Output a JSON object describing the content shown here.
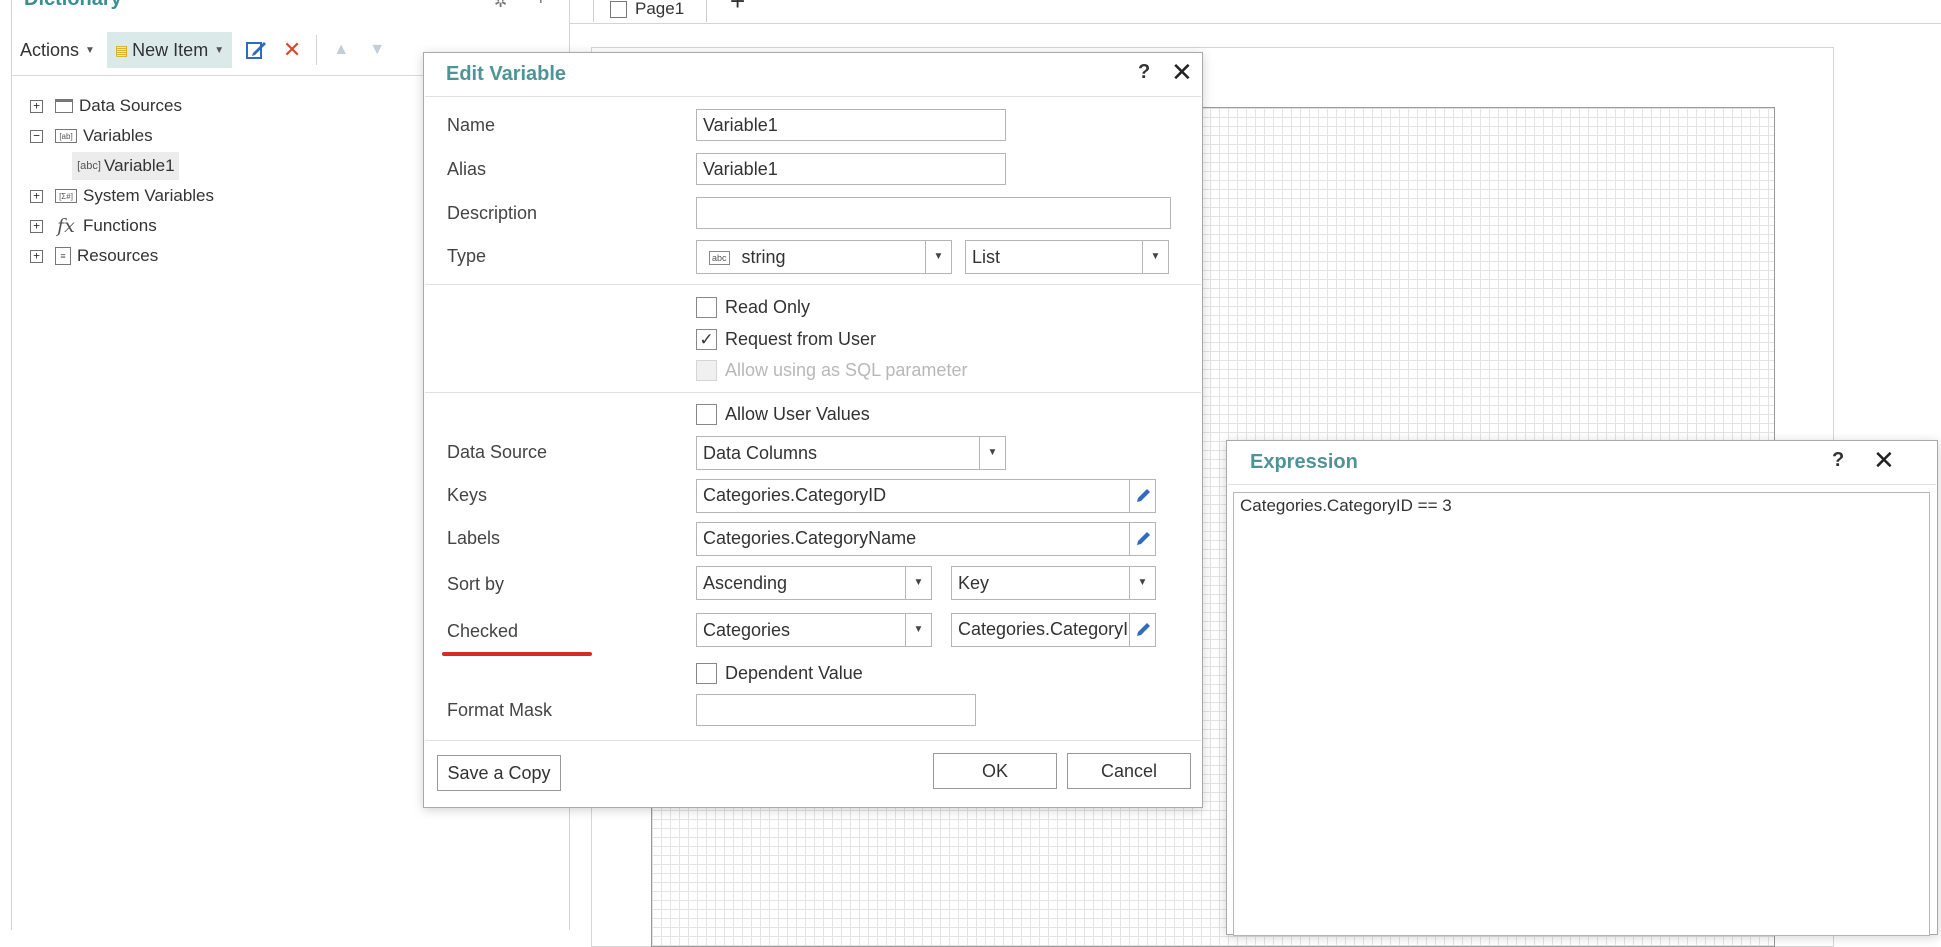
{
  "dictionary": {
    "title": "Dictionary",
    "toolbar": {
      "actions_label": "Actions",
      "new_item_label": "New Item"
    },
    "tree": [
      {
        "label": "Data Sources",
        "expander": "+"
      },
      {
        "label": "Variables",
        "expander": "−"
      },
      {
        "label": "Variable1"
      },
      {
        "label": "System Variables",
        "expander": "+"
      },
      {
        "label": "Functions",
        "expander": "+"
      },
      {
        "label": "Resources",
        "expander": "+"
      }
    ]
  },
  "designer": {
    "page_tab_label": "Page1"
  },
  "edit_variable": {
    "title": "Edit Variable",
    "help": "?",
    "close": "✕",
    "name_label": "Name",
    "name_value": "Variable1",
    "alias_label": "Alias",
    "alias_value": "Variable1",
    "description_label": "Description",
    "description_value": "",
    "type_label": "Type",
    "type_value": "string",
    "type_icon_text": "abc",
    "type_kind_value": "List",
    "read_only_label": "Read Only",
    "request_from_user_label": "Request from User",
    "sql_param_label": "Allow using as SQL parameter",
    "allow_user_values_label": "Allow User Values",
    "data_source_label": "Data Source",
    "data_source_value": "Data Columns",
    "keys_label": "Keys",
    "keys_value": "Categories.CategoryID",
    "labels_label": "Labels",
    "labels_value": "Categories.CategoryName",
    "sort_by_label": "Sort by",
    "sort_by_value": "Ascending",
    "sort_field_value": "Key",
    "checked_label": "Checked",
    "checked_source_value": "Categories",
    "checked_expr_value": "Categories.CategoryI",
    "dependent_value_label": "Dependent Value",
    "format_mask_label": "Format Mask",
    "format_mask_value": "",
    "save_copy_label": "Save a Copy",
    "ok_label": "OK",
    "cancel_label": "Cancel",
    "underline_color": "#d52b26"
  },
  "expression": {
    "title": "Expression",
    "help": "?",
    "close": "✕",
    "text": "Categories.CategoryID == 3"
  }
}
